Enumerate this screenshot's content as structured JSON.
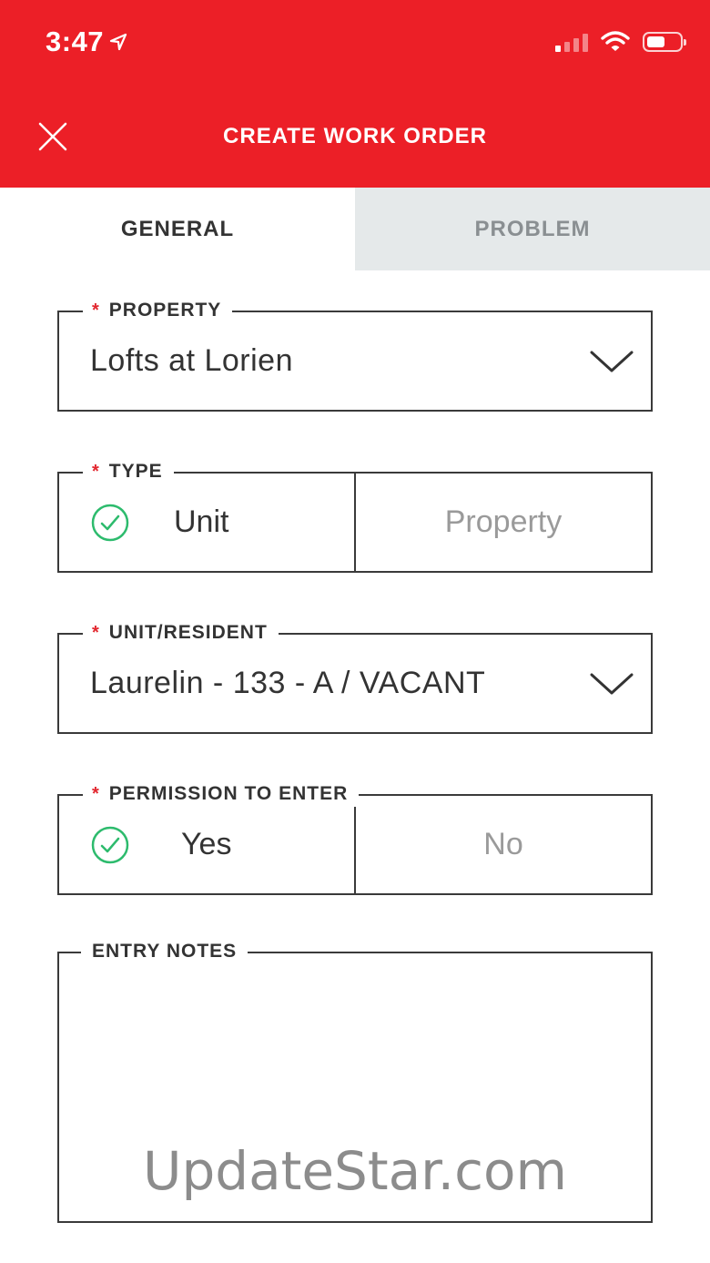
{
  "status_bar": {
    "time": "3:47",
    "location_icon": "location-arrow-icon",
    "signal_icon": "cellular-signal-icon",
    "wifi_icon": "wifi-icon",
    "battery_icon": "battery-icon",
    "signal_bars_on": 1,
    "signal_bars_total": 4,
    "battery_level": 0.55
  },
  "header": {
    "title": "CREATE WORK ORDER",
    "close_icon": "close-icon",
    "background_color": "#ec1f27"
  },
  "tabs": [
    {
      "label": "GENERAL",
      "active": true
    },
    {
      "label": "PROBLEM",
      "active": false
    }
  ],
  "form": {
    "property": {
      "label": "PROPERTY",
      "required_mark": "*",
      "value": "Lofts at Lorien",
      "icon": "chevron-down-icon"
    },
    "type": {
      "label": "TYPE",
      "required_mark": "*",
      "options": [
        {
          "label": "Unit",
          "selected": true
        },
        {
          "label": "Property",
          "selected": false
        }
      ],
      "selected_icon": "check-circle-icon"
    },
    "unit_resident": {
      "label": "UNIT/RESIDENT",
      "required_mark": "*",
      "value": "Laurelin - 133 - A / VACANT",
      "icon": "chevron-down-icon"
    },
    "permission_to_enter": {
      "label": "PERMISSION TO ENTER",
      "required_mark": "*",
      "options": [
        {
          "label": "Yes",
          "selected": true
        },
        {
          "label": "No",
          "selected": false
        }
      ],
      "selected_icon": "check-circle-icon"
    },
    "entry_notes": {
      "label": "ENTRY NOTES",
      "value": ""
    }
  },
  "watermark": "UpdateStar.com",
  "colors": {
    "accent_red": "#ec1f27",
    "check_green": "#2dbb6d",
    "inactive_tab_bg": "#e5e9ea"
  }
}
